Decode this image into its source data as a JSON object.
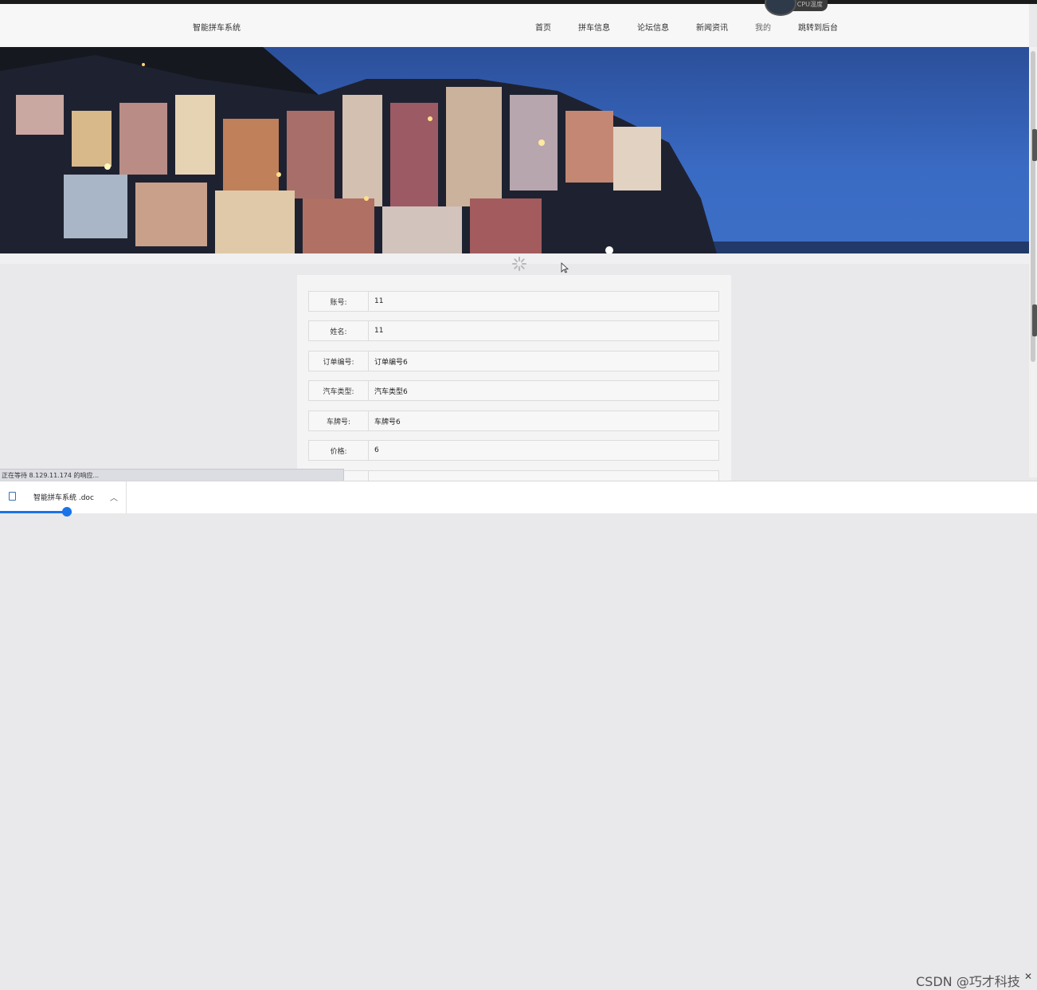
{
  "header": {
    "brand": "智能拼车系统",
    "nav": [
      {
        "label": "首页"
      },
      {
        "label": "拼车信息"
      },
      {
        "label": "论坛信息"
      },
      {
        "label": "新闻资讯"
      },
      {
        "label": "我的"
      },
      {
        "label": "跳转到后台"
      }
    ],
    "cpu_widget": "CPU温度"
  },
  "detail": {
    "rows": [
      {
        "label": "账号:",
        "value": "11"
      },
      {
        "label": "姓名:",
        "value": "11"
      },
      {
        "label": "订单编号:",
        "value": "订单编号6"
      },
      {
        "label": "汽车类型:",
        "value": "汽车类型6"
      },
      {
        "label": "车牌号:",
        "value": "车牌号6"
      },
      {
        "label": "价格:",
        "value": "6"
      }
    ]
  },
  "status_bar": {
    "text": "正在等待 8.129.11.174 的响应..."
  },
  "downloads": {
    "file_name": "智能拼车系统 .doc",
    "progress": 0.57
  },
  "watermark": "CSDN @巧才科技",
  "icons": {
    "file": "document-icon",
    "chevron": "chevron-up-icon",
    "close": "close-icon",
    "spinner": "loading-spinner-icon",
    "cursor": "mouse-cursor-icon"
  }
}
